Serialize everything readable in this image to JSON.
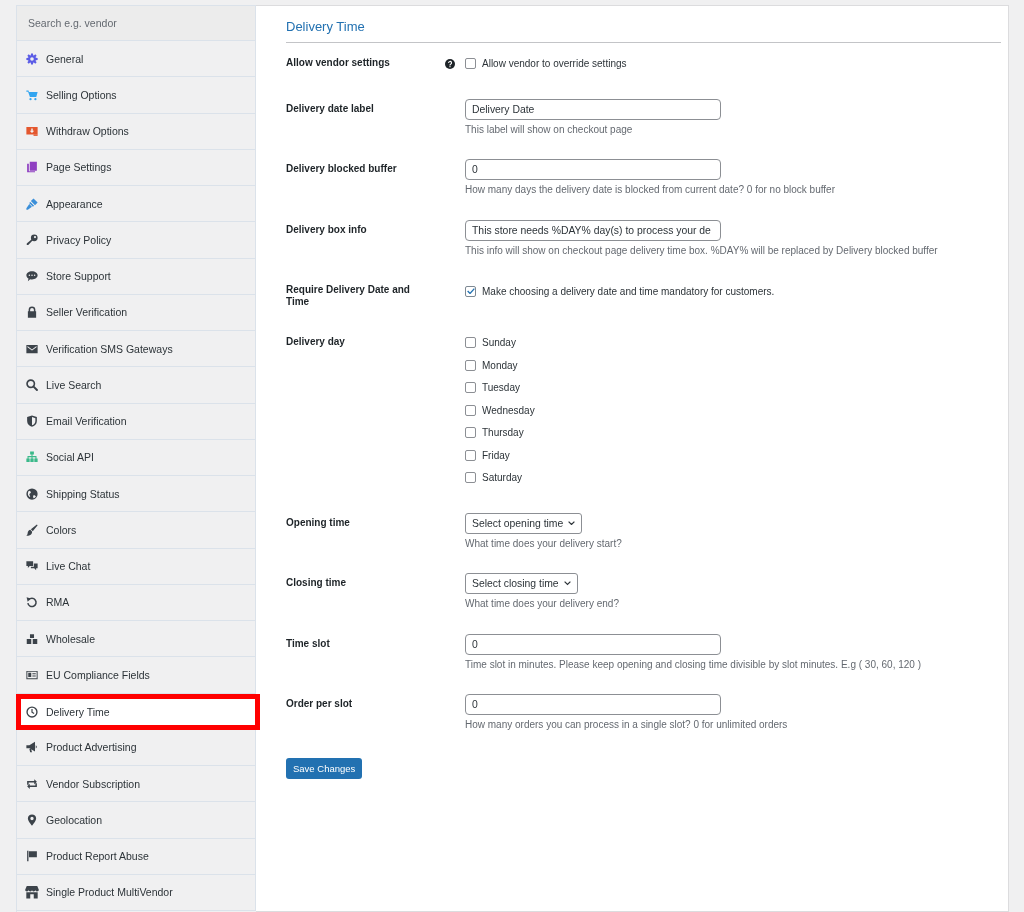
{
  "sidebar": {
    "search": {
      "placeholder": "Search e.g. vendor"
    },
    "items": [
      {
        "label": "General",
        "selected": false,
        "highlighted": false
      },
      {
        "label": "Selling Options",
        "selected": false,
        "highlighted": false
      },
      {
        "label": "Withdraw Options",
        "selected": false,
        "highlighted": false
      },
      {
        "label": "Page Settings",
        "selected": false,
        "highlighted": false
      },
      {
        "label": "Appearance",
        "selected": false,
        "highlighted": false
      },
      {
        "label": "Privacy Policy",
        "selected": false,
        "highlighted": false
      },
      {
        "label": "Store Support",
        "selected": false,
        "highlighted": false
      },
      {
        "label": "Seller Verification",
        "selected": false,
        "highlighted": false
      },
      {
        "label": "Verification SMS Gateways",
        "selected": false,
        "highlighted": false
      },
      {
        "label": "Live Search",
        "selected": false,
        "highlighted": false
      },
      {
        "label": "Email Verification",
        "selected": false,
        "highlighted": false
      },
      {
        "label": "Social API",
        "selected": false,
        "highlighted": false
      },
      {
        "label": "Shipping Status",
        "selected": false,
        "highlighted": false
      },
      {
        "label": "Colors",
        "selected": false,
        "highlighted": false
      },
      {
        "label": "Live Chat",
        "selected": false,
        "highlighted": false
      },
      {
        "label": "RMA",
        "selected": false,
        "highlighted": false
      },
      {
        "label": "Wholesale",
        "selected": false,
        "highlighted": false
      },
      {
        "label": "EU Compliance Fields",
        "selected": false,
        "highlighted": false
      },
      {
        "label": "Delivery Time",
        "selected": true,
        "highlighted": true
      },
      {
        "label": "Product Advertising",
        "selected": false,
        "highlighted": false
      },
      {
        "label": "Vendor Subscription",
        "selected": false,
        "highlighted": false
      },
      {
        "label": "Geolocation",
        "selected": false,
        "highlighted": false
      },
      {
        "label": "Product Report Abuse",
        "selected": false,
        "highlighted": false
      },
      {
        "label": "Single Product MultiVendor",
        "selected": false,
        "highlighted": false
      }
    ]
  },
  "panel": {
    "title": "Delivery Time",
    "fields": [
      {
        "kind": "checkbox",
        "label": "Allow vendor settings",
        "help": true,
        "options": [
          {
            "label": "Allow vendor to override settings",
            "checked": false
          }
        ]
      },
      {
        "kind": "text",
        "label": "Delivery date label",
        "help": false,
        "value": "Delivery Date",
        "description": "This label will show on checkout page"
      },
      {
        "kind": "text",
        "label": "Delivery blocked buffer",
        "help": false,
        "value": "0",
        "description": "How many days the delivery date is blocked from current date? 0 for no block buffer"
      },
      {
        "kind": "text",
        "label": "Delivery box info",
        "help": false,
        "value": "This store needs %DAY% day(s) to process your de",
        "description": "This info will show on checkout page delivery time box. %DAY% will be replaced by Delivery blocked buffer"
      },
      {
        "kind": "checkbox",
        "label": "Require Delivery Date and Time",
        "help": false,
        "options": [
          {
            "label": "Make choosing a delivery date and time mandatory for customers.",
            "checked": true
          }
        ]
      },
      {
        "kind": "checkbox",
        "label": "Delivery day",
        "help": false,
        "options": [
          {
            "label": "Sunday",
            "checked": false
          },
          {
            "label": "Monday",
            "checked": false
          },
          {
            "label": "Tuesday",
            "checked": false
          },
          {
            "label": "Wednesday",
            "checked": false
          },
          {
            "label": "Thursday",
            "checked": false
          },
          {
            "label": "Friday",
            "checked": false
          },
          {
            "label": "Saturday",
            "checked": false
          }
        ]
      },
      {
        "kind": "select",
        "label": "Opening time",
        "help": false,
        "value": "Select opening time",
        "description": "What time does your delivery start?"
      },
      {
        "kind": "select",
        "label": "Closing time",
        "help": false,
        "value": "Select closing time",
        "description": "What time does your delivery end?"
      },
      {
        "kind": "text",
        "label": "Time slot",
        "help": false,
        "value": "0",
        "description": "Time slot in minutes. Please keep opening and closing time divisible by slot minutes. E.g ( 30, 60, 120 )"
      },
      {
        "kind": "text",
        "label": "Order per slot",
        "help": false,
        "value": "0",
        "description": "How many orders you can process in a single slot? 0 for unlimited orders"
      }
    ],
    "save_button": "Save Changes"
  }
}
